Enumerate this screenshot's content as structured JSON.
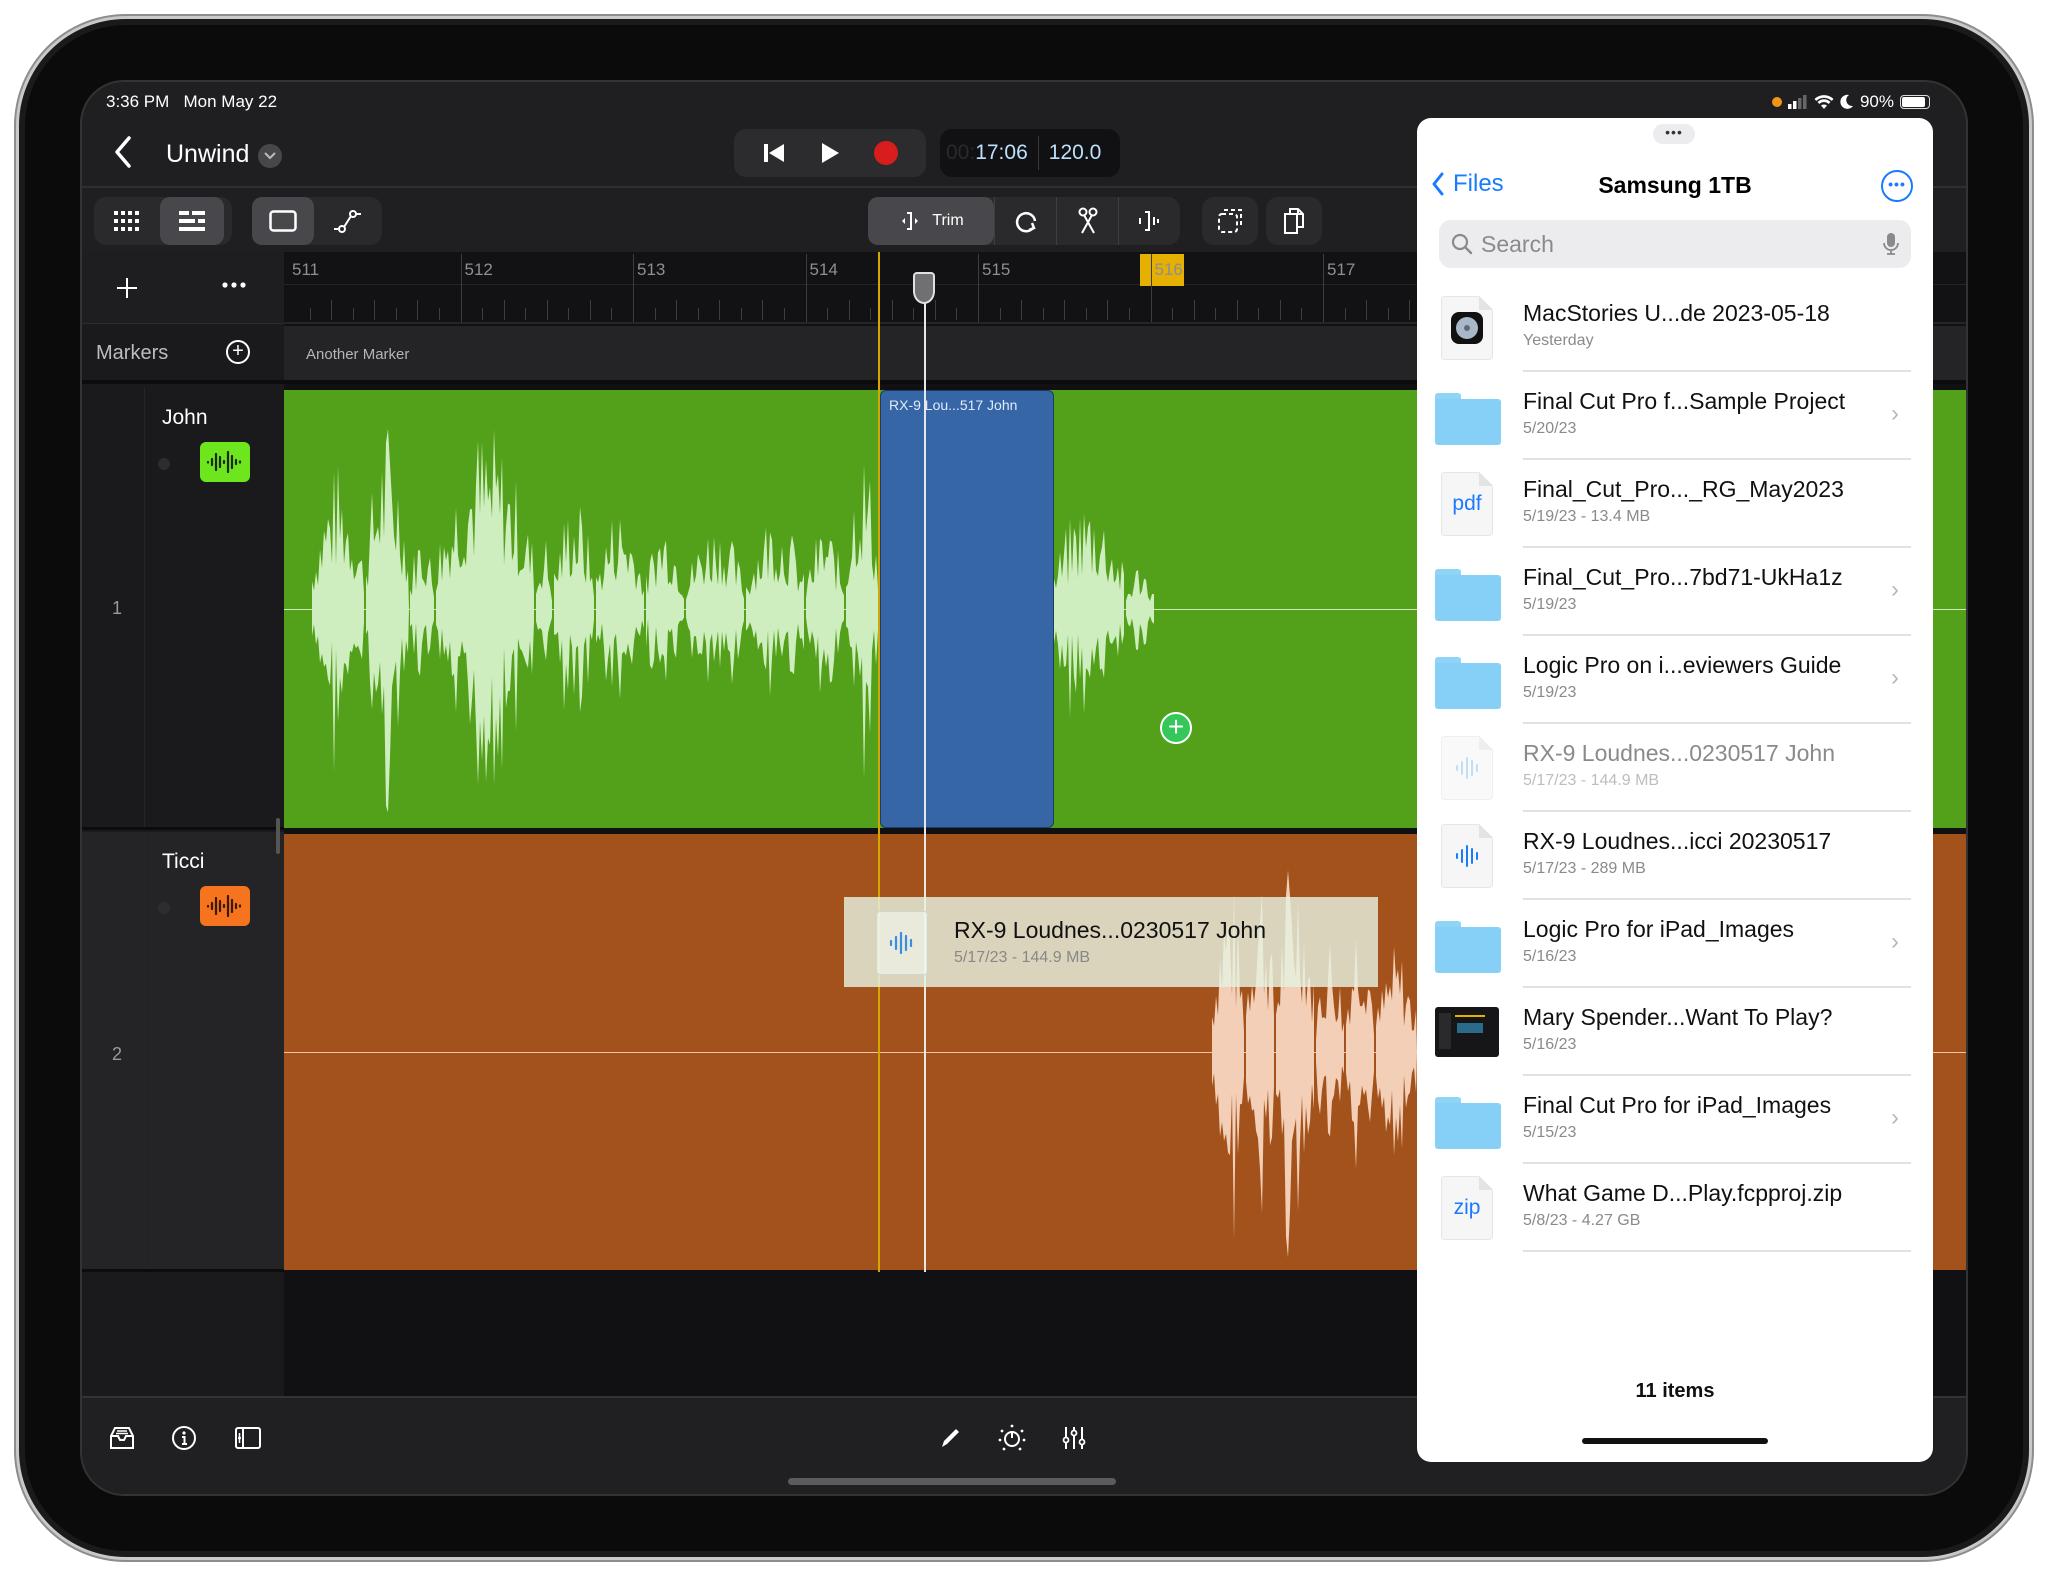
{
  "status_bar": {
    "time": "3:36 PM",
    "date": "Mon May 22",
    "battery": "90%",
    "icons": [
      "privacy-dot-icon",
      "cellular-icon",
      "wifi-icon",
      "moon-icon",
      "battery-icon"
    ]
  },
  "project": {
    "back_icon": "chevron-left-icon",
    "title": "Unwind",
    "menu_icon": "chevron-down-icon"
  },
  "transport": {
    "buttons": [
      "go-to-beginning-icon",
      "play-icon",
      "record-icon"
    ],
    "time_dim": "00:",
    "time": "17:06",
    "tempo": "120.0",
    "record_color": "#d81d1d"
  },
  "toolbar": {
    "view_buttons": [
      "grid-view-icon",
      "tracks-view-icon"
    ],
    "edit_mode_buttons": [
      "region-mode-icon",
      "automation-mode-icon"
    ],
    "trim_label": "Trim",
    "tools": [
      "trim-icon",
      "loop-icon",
      "scissors-icon",
      "split-icon"
    ],
    "actions": [
      "select-icon",
      "copy-icon"
    ]
  },
  "timeline": {
    "add_track_icon": "plus-icon",
    "more_icon": "ellipsis-icon",
    "markers_label": "Markers",
    "add_marker_icon": "plus-circle-icon",
    "ruler_labels": [
      "511",
      "512",
      "513",
      "514",
      "515",
      "516",
      "517"
    ],
    "marker_name": "Another Marker",
    "locator_color": "#e5b000"
  },
  "tracks": [
    {
      "number": "1",
      "name": "John",
      "color": "#53a01b",
      "icon_color": "#6ee61e",
      "icon": "waveform-icon"
    },
    {
      "number": "2",
      "name": "Ticci",
      "color": "#a3521b",
      "icon_color": "#f5741d",
      "icon": "waveform-icon"
    }
  ],
  "blue_region": {
    "label": "RX-9 Lou...517 John",
    "color": "#3666a6"
  },
  "drag_preview": {
    "name": "RX-9 Loudnes...0230517 John",
    "meta": "5/17/23 - 144.9 MB",
    "badge_icon": "plus-badge-icon"
  },
  "bottom_bar": {
    "left": [
      "browser-icon",
      "info-icon",
      "inspector-icon"
    ],
    "center": [
      "pencil-icon",
      "smart-controls-icon",
      "mixer-icon"
    ]
  },
  "files_panel": {
    "grabber": "•••",
    "back_label": "Files",
    "title": "Samsung 1TB",
    "more_icon": "ellipsis-circle-icon",
    "search_placeholder": "Search",
    "accent": "#1a7bff",
    "items": [
      {
        "name": "MacStories U...de 2023-05-18",
        "meta": "Yesterday",
        "type": "app-doc",
        "chevron": false,
        "dim": false
      },
      {
        "name": "Final Cut Pro f...Sample Project",
        "meta": "5/20/23",
        "type": "folder",
        "chevron": true,
        "dim": false
      },
      {
        "name": "Final_Cut_Pro..._RG_May2023",
        "meta": "5/19/23 - 13.4 MB",
        "type": "pdf",
        "chevron": false,
        "dim": false
      },
      {
        "name": "Final_Cut_Pro...7bd71-UkHa1z",
        "meta": "5/19/23",
        "type": "folder",
        "chevron": true,
        "dim": false
      },
      {
        "name": "Logic Pro on i...eviewers Guide",
        "meta": "5/19/23",
        "type": "folder",
        "chevron": true,
        "dim": false
      },
      {
        "name": "RX-9 Loudnes...0230517 John",
        "meta": "5/17/23 - 144.9 MB",
        "type": "audio",
        "chevron": false,
        "dim": true
      },
      {
        "name": "RX-9 Loudnes...icci 20230517",
        "meta": "5/17/23 - 289 MB",
        "type": "audio",
        "chevron": false,
        "dim": false
      },
      {
        "name": "Logic Pro for iPad_Images",
        "meta": "5/16/23",
        "type": "folder",
        "chevron": true,
        "dim": false
      },
      {
        "name": "Mary Spender...Want To Play?",
        "meta": "5/16/23",
        "type": "image",
        "chevron": false,
        "dim": false
      },
      {
        "name": "Final Cut Pro for iPad_Images",
        "meta": "5/15/23",
        "type": "folder",
        "chevron": true,
        "dim": false
      },
      {
        "name": "What Game D...Play.fcpproj.zip",
        "meta": "5/8/23 - 4.27 GB",
        "type": "zip",
        "chevron": false,
        "dim": false
      }
    ],
    "count": "11 items",
    "pdf_label": "pdf",
    "zip_label": "zip",
    "chevron": "›"
  }
}
